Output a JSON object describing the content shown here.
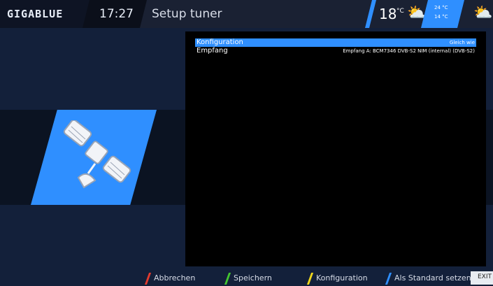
{
  "header": {
    "logo": "GIGABLUE",
    "time": "17:27",
    "title": "Setup tuner",
    "weather": {
      "current_temp": "18",
      "current_unit": "°C",
      "high": "24 °C",
      "low": "14 °C"
    },
    "icons": [
      "cloud-sun-icon",
      "cloud-sun-icon"
    ]
  },
  "settings": [
    {
      "label": "Konfiguration",
      "value": "Gleich wie",
      "selected": true
    },
    {
      "label": "Empfang",
      "value": "Empfang A: BCM7346 DVB-S2 NIM (internal) (DVB-S2)",
      "selected": false
    }
  ],
  "footer": {
    "buttons": [
      {
        "label": "Abbrechen",
        "color": "#e33b2e"
      },
      {
        "label": "Speichern",
        "color": "#43c530"
      },
      {
        "label": "Konfiguration",
        "color": "#f0d71c"
      },
      {
        "label": "Als Standard setzen",
        "color": "#2f8fff"
      }
    ],
    "exit": "EXIT"
  },
  "colors": {
    "accent": "#2f8fff",
    "background": "#13203a",
    "panel": "#000000"
  }
}
